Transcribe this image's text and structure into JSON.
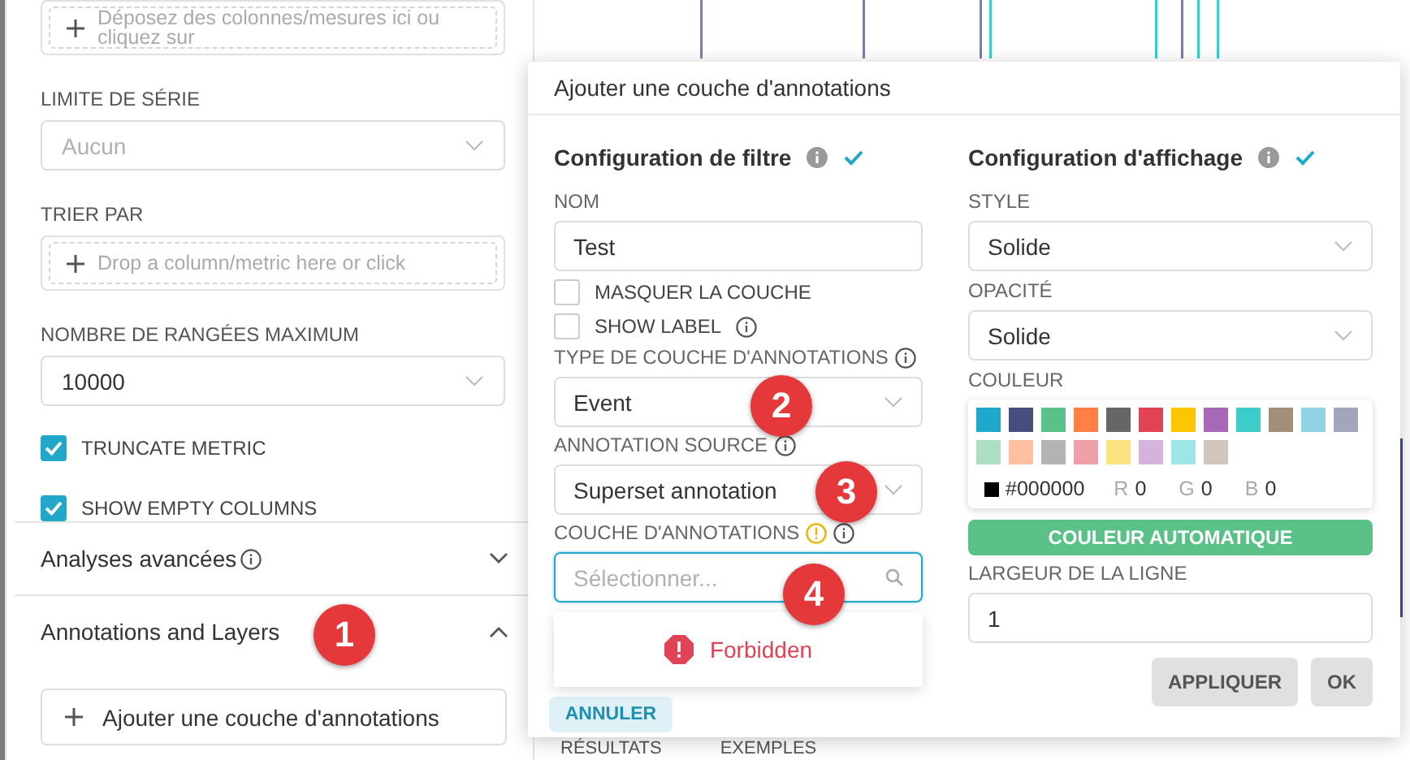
{
  "sidebar": {
    "controls": [
      {
        "kind": "dropzone",
        "placeholder": "Déposez des colonnes/mesures ici ou cliquez sur"
      },
      {
        "kind": "select",
        "label": "LIMITE DE SÉRIE",
        "placeholder": "Aucun"
      },
      {
        "kind": "dropzone",
        "label": "TRIER PAR",
        "placeholder": "Drop a column/metric here or click"
      },
      {
        "kind": "select",
        "label": "NOMBRE DE RANGÉES MAXIMUM",
        "value": "10000"
      },
      {
        "kind": "checkbox",
        "label": "TRUNCATE METRIC",
        "checked": true
      },
      {
        "kind": "checkbox",
        "label": "SHOW EMPTY COLUMNS",
        "checked": true
      }
    ],
    "sections": [
      {
        "title": "Analyses avancées",
        "info": true,
        "expanded": false
      },
      {
        "title": "Annotations and Layers",
        "info": false,
        "expanded": true,
        "button": "Ajouter une couche d'annotations"
      }
    ]
  },
  "popover": {
    "title": "Ajouter une couche d'annotations",
    "filter": {
      "title": "Configuration de filtre",
      "fields": [
        {
          "kind": "input",
          "label": "NOM",
          "value": "Test"
        },
        {
          "kind": "checkbox",
          "label": "MASQUER LA COUCHE",
          "checked": false,
          "info": false
        },
        {
          "kind": "checkbox",
          "label": "SHOW LABEL",
          "checked": false,
          "info": true
        },
        {
          "kind": "select",
          "label": "TYPE DE COUCHE D'ANNOTATIONS",
          "info": true,
          "value": "Event"
        },
        {
          "kind": "select",
          "label": "ANNOTATION SOURCE",
          "info": true,
          "value": "Superset annotation"
        },
        {
          "kind": "search",
          "label": "COUCHE D'ANNOTATIONS",
          "warning": true,
          "info": true,
          "placeholder": "Sélectionner...",
          "focused": true
        }
      ],
      "dropdown": {
        "message": "Forbidden"
      },
      "cancel": "ANNULER"
    },
    "display": {
      "title": "Configuration d'affichage",
      "fields": [
        {
          "kind": "select",
          "label": "STYLE",
          "value": "Solide"
        },
        {
          "kind": "select",
          "label": "OPACITÉ",
          "value": "Solide"
        }
      ],
      "color": {
        "label": "COULEUR",
        "swatches": [
          {
            "color": "#1fa8c9"
          },
          {
            "color": "#454e7c"
          },
          {
            "color": "#5ac189"
          },
          {
            "color": "#ff7f44"
          },
          {
            "color": "#666666"
          },
          {
            "color": "#e04355"
          },
          {
            "color": "#fcc700"
          },
          {
            "color": "#a868b7"
          },
          {
            "color": "#3cccca"
          },
          {
            "color": "#a38f79"
          },
          {
            "color": "#8fd3e4"
          },
          {
            "color": "#a1a6bd"
          },
          {
            "color": "#acdec4"
          },
          {
            "color": "#ffbfa1"
          },
          {
            "color": "#b3b3b3"
          },
          {
            "color": "#ef9fa8"
          },
          {
            "color": "#fde380"
          },
          {
            "color": "#d4b3dc"
          },
          {
            "color": "#9ee5e5"
          },
          {
            "color": "#d1c6bc"
          }
        ],
        "current": {
          "color": "#000000",
          "hex": "#000000"
        },
        "channels": [
          {
            "name": "R",
            "value": "0"
          },
          {
            "name": "G",
            "value": "0"
          },
          {
            "name": "B",
            "value": "0"
          }
        ]
      },
      "auto_button": "COULEUR AUTOMATIQUE",
      "width_field": {
        "label": "LARGEUR DE LA LIGNE",
        "value": "1"
      },
      "buttons": [
        "APPLIQUER",
        "OK"
      ]
    }
  },
  "result_tabs": [
    "RÉSULTATS",
    "EXEMPLES"
  ],
  "markers": [
    "1",
    "2",
    "3",
    "4"
  ]
}
